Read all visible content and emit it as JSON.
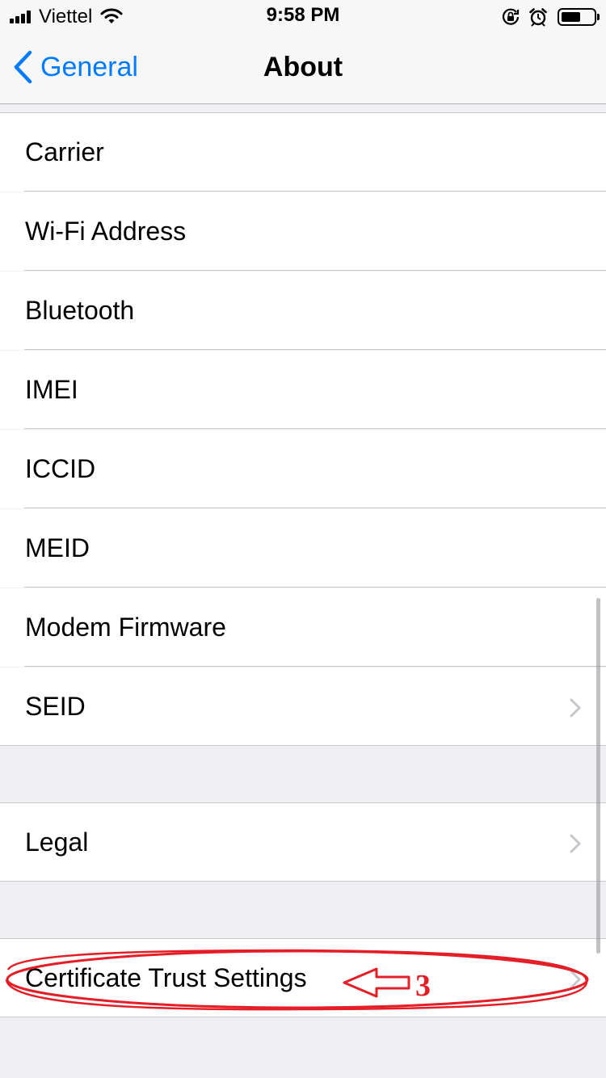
{
  "status_bar": {
    "carrier": "Viettel",
    "time": "9:58 PM",
    "signal_bars": 4,
    "battery_level": 0.6,
    "icons": [
      "signal-icon",
      "wifi-icon",
      "orientation-lock-icon",
      "alarm-icon",
      "battery-icon"
    ]
  },
  "nav": {
    "back_label": "General",
    "title": "About"
  },
  "rows": [
    {
      "label": "Carrier",
      "disclosure": false
    },
    {
      "label": "Wi-Fi Address",
      "disclosure": false
    },
    {
      "label": "Bluetooth",
      "disclosure": false
    },
    {
      "label": "IMEI",
      "disclosure": false
    },
    {
      "label": "ICCID",
      "disclosure": false
    },
    {
      "label": "MEID",
      "disclosure": false
    },
    {
      "label": "Modem Firmware",
      "disclosure": false
    },
    {
      "label": "SEID",
      "disclosure": true
    }
  ],
  "legal": {
    "label": "Legal",
    "disclosure": true
  },
  "certificate": {
    "label": "Certificate Trust Settings",
    "disclosure": true
  },
  "annotation": {
    "step_number": "3",
    "color": "#e41e26"
  },
  "colors": {
    "accent": "#007aff",
    "background": "#efeff4",
    "separator": "#c8c7cc",
    "chevron": "#c7c7cc"
  }
}
